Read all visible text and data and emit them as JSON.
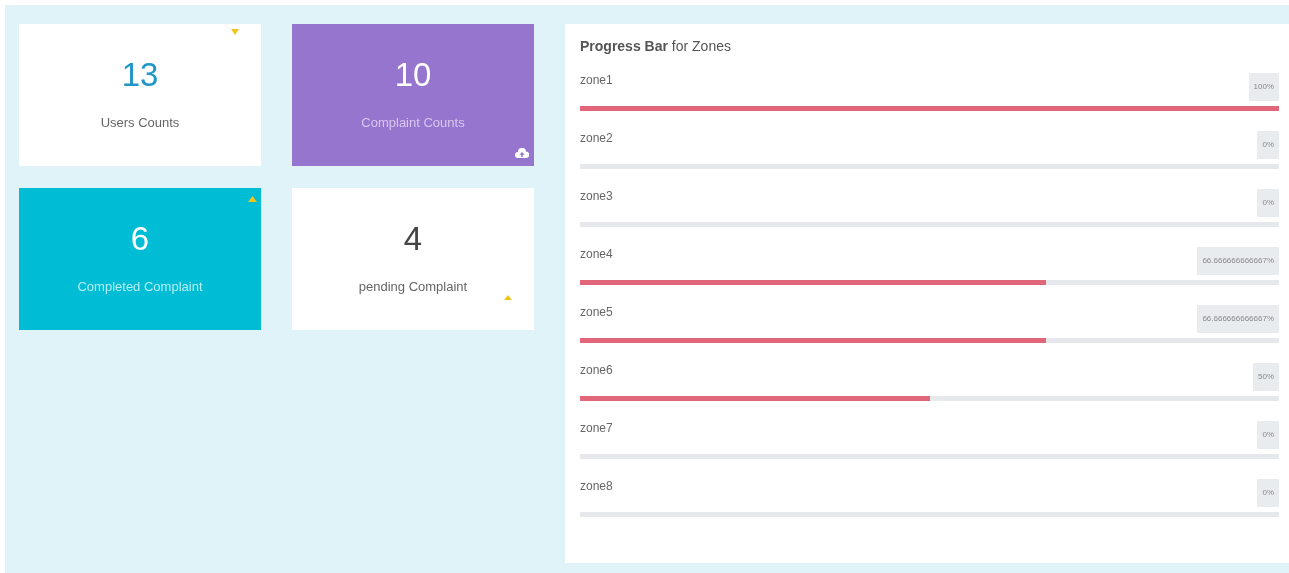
{
  "stat_cards": [
    {
      "kind": "white",
      "value": "13",
      "label": "Users Counts"
    },
    {
      "kind": "purple",
      "value": "10",
      "label": "Complaint Counts"
    },
    {
      "kind": "teal",
      "value": "6",
      "label": "Completed Complaint"
    },
    {
      "kind": "plain",
      "value": "4",
      "label": "pending Complaint"
    }
  ],
  "zones_panel": {
    "title": "**Progress Bar** for Zones",
    "zones": [
      {
        "name": "zone1",
        "reading": "100%",
        "level": 1
      },
      {
        "name": "zone2",
        "reading": "0%",
        "level": 0
      },
      {
        "name": "zone3",
        "reading": "0%",
        "level": 0
      },
      {
        "name": "zone4",
        "reading": "66.666666666667%",
        "level": 0.6667
      },
      {
        "name": "zone5",
        "reading": "66.666666666667%",
        "level": 0.6667
      },
      {
        "name": "zone6",
        "reading": "50%",
        "level": 0.5
      },
      {
        "name": "zone7",
        "reading": "0%",
        "level": 0
      },
      {
        "name": "zone8",
        "reading": "0%",
        "level": 0
      }
    ]
  }
}
